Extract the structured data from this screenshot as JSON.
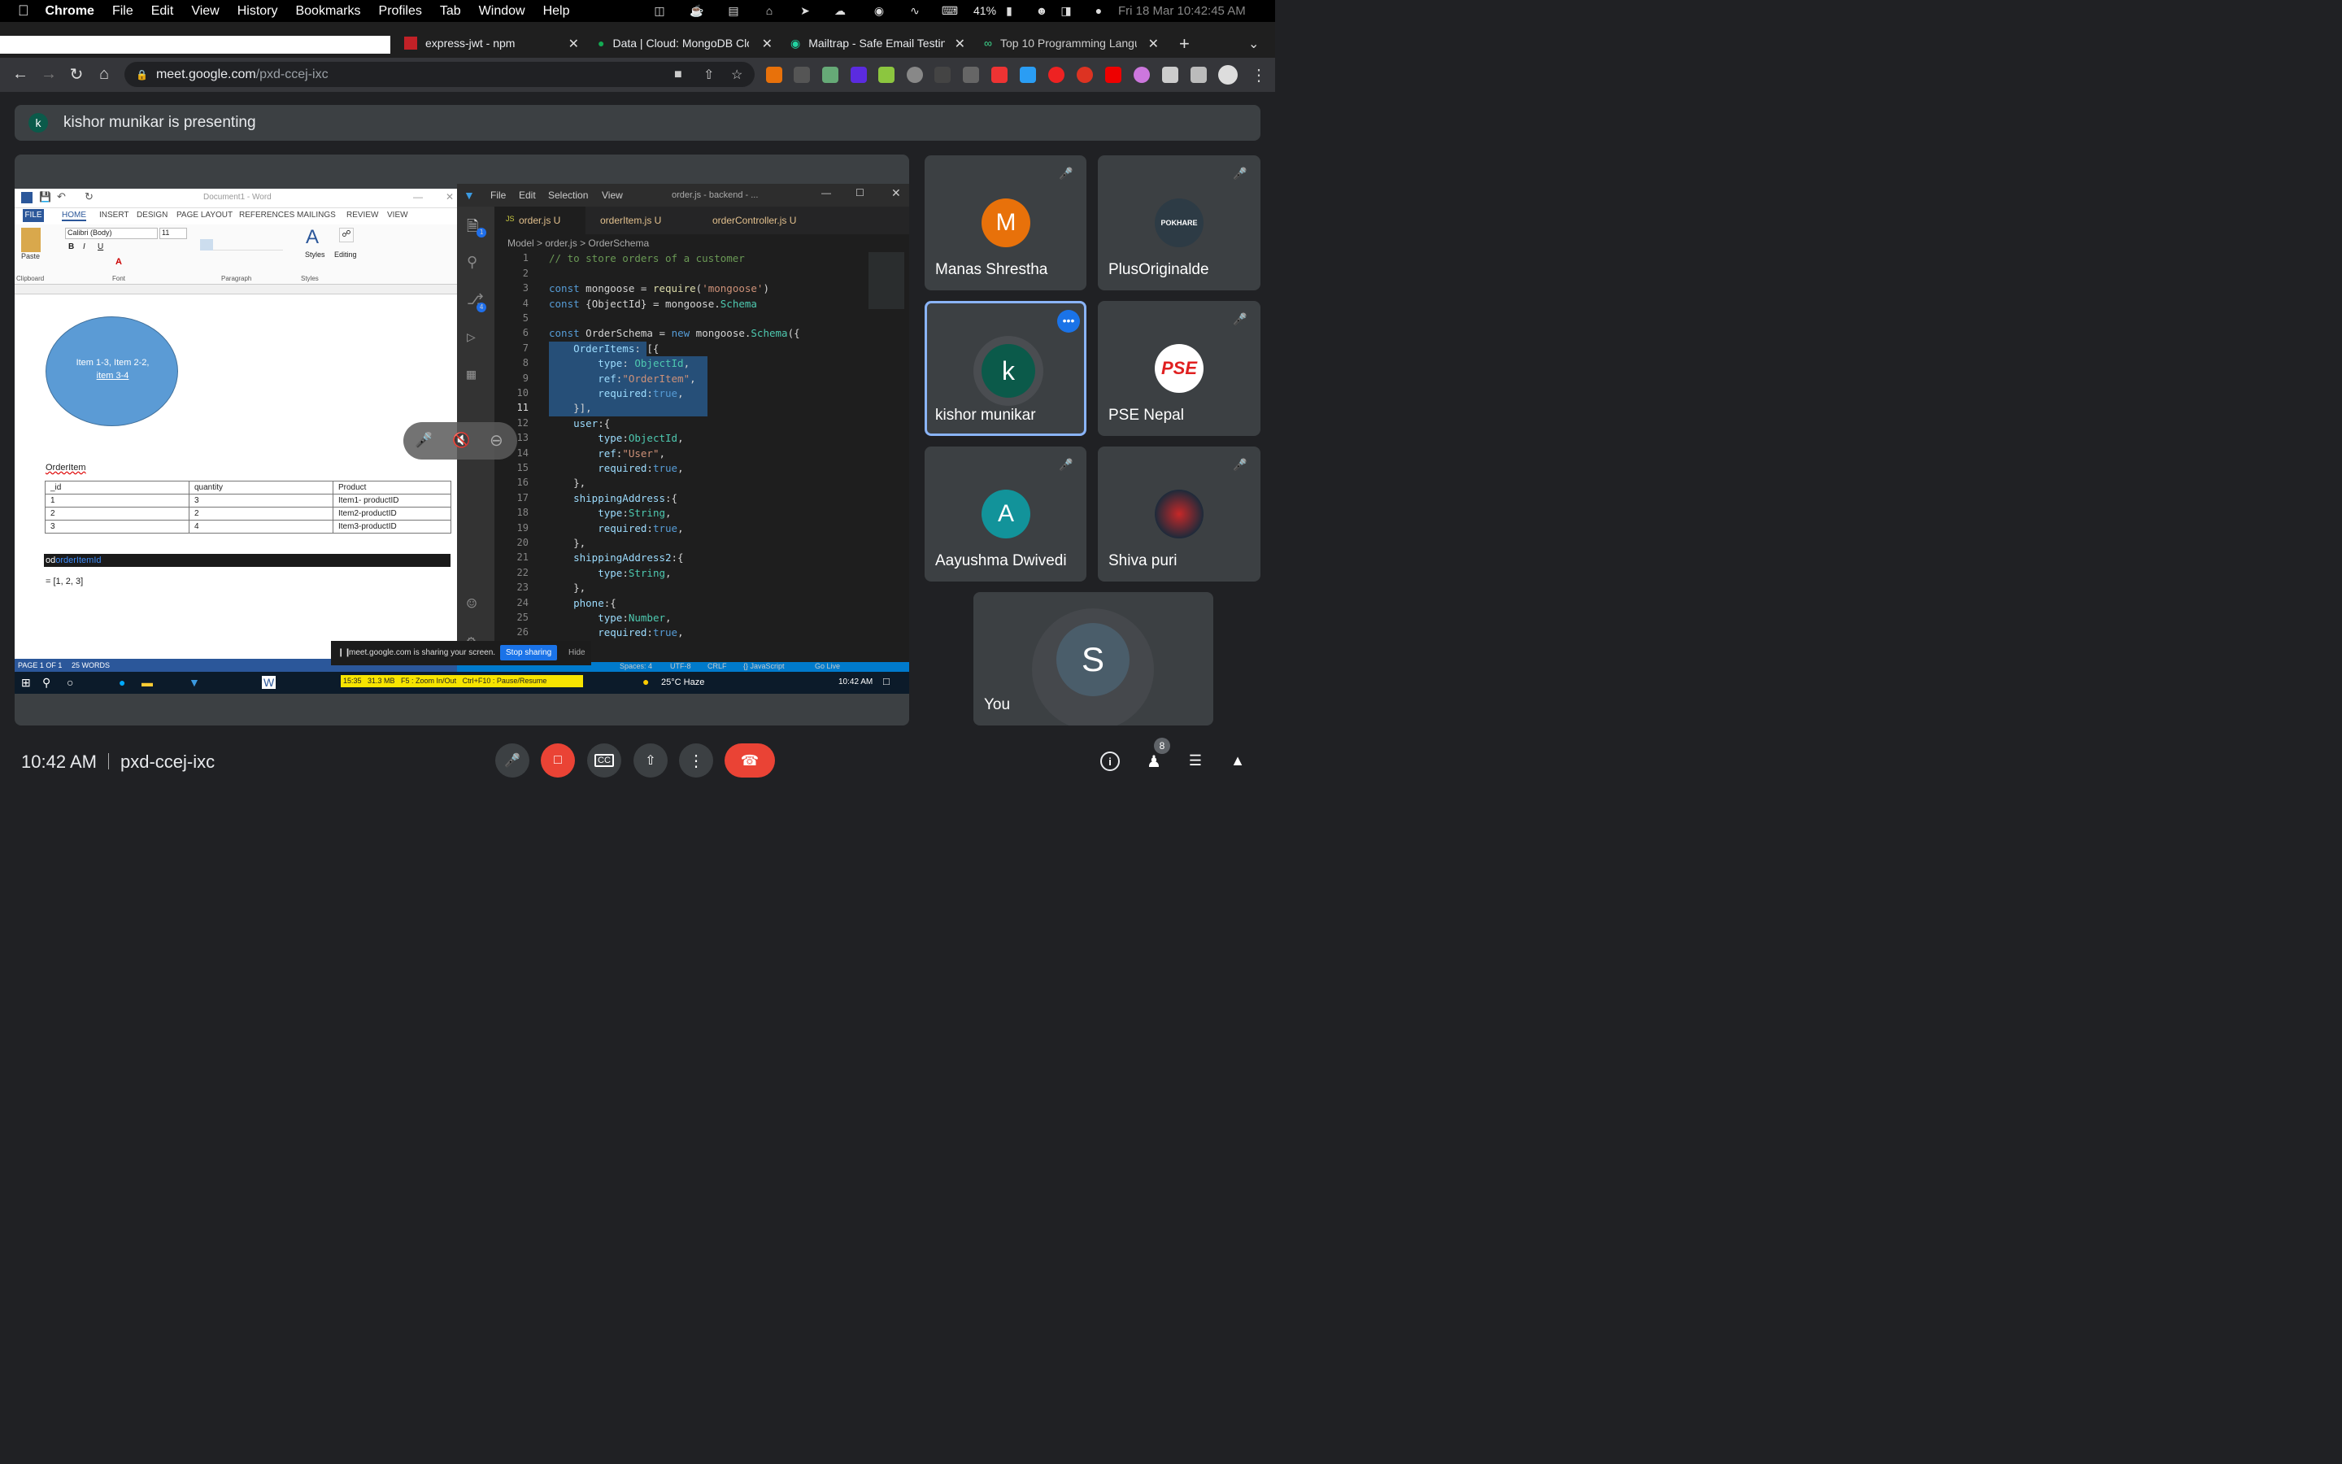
{
  "menubar": {
    "app": "Chrome",
    "items": [
      "File",
      "Edit",
      "View",
      "History",
      "Bookmarks",
      "Profiles",
      "Tab",
      "Window",
      "Help"
    ],
    "battery": "41%",
    "datetime": "Fri 18 Mar  10:42:45 AM"
  },
  "tabs": [
    {
      "label": "express-jwt - npm"
    },
    {
      "label": "Data | Cloud: MongoDB Clo"
    },
    {
      "label": "Mailtrap - Safe Email Testin"
    },
    {
      "label": "Top 10 Programming Langu"
    }
  ],
  "address": {
    "host": "meet.google.com",
    "path": "/pxd-ccej-ixc"
  },
  "meet": {
    "presenter_initial": "k",
    "presenting_text": "kishor munikar is presenting",
    "meeting_time": "10:42 AM",
    "meeting_code": "pxd-ccej-ixc",
    "people_count": "8",
    "participants": [
      {
        "name": "Manas Shrestha",
        "initial": "M",
        "color": "#e8710a"
      },
      {
        "name": "PlusOriginalde",
        "avatar_text": "POKHARE"
      },
      {
        "name": "kishor munikar",
        "initial": "k",
        "color": "#0b5a4a"
      },
      {
        "name": "PSE Nepal",
        "avatar_text": "PSE"
      },
      {
        "name": "Aayushma Dwivedi",
        "initial": "A",
        "color": "#12939a"
      },
      {
        "name": "Shiva puri"
      },
      {
        "name": "You",
        "initial": "S",
        "color": "#4a5d6a"
      }
    ],
    "share_banner": {
      "text": "meet.google.com is sharing your screen.",
      "stop": "Stop sharing",
      "hide": "Hide"
    }
  },
  "word": {
    "title": "Document1 - Word",
    "ribbon_tabs": [
      "FILE",
      "HOME",
      "INSERT",
      "DESIGN",
      "PAGE LAYOUT",
      "REFERENCES",
      "MAILINGS",
      "REVIEW",
      "VIEW"
    ],
    "font_name": "Calibri (Body)",
    "font_size": "11",
    "groups": [
      "Clipboard",
      "Font",
      "Paragraph",
      "Styles"
    ],
    "paste": "Paste",
    "styles": "Styles",
    "editing": "Editing",
    "ellipse_line1": "Item 1-3, Item 2-2,",
    "ellipse_line2": "item 3-4",
    "section_label": "OrderItem",
    "table_headers": [
      "_id",
      "quantity",
      "Product"
    ],
    "table_rows": [
      [
        "1",
        "3",
        "Item1- productID"
      ],
      [
        "2",
        "2",
        "Item2-productID"
      ],
      [
        "3",
        "4",
        "Item3-productID"
      ]
    ],
    "code_bar_prefix": "od",
    "code_bar_text": "orderItemId",
    "array_line": "= [1, 2, 3]",
    "status_page": "PAGE 1 OF 1",
    "status_words": "25 WORDS"
  },
  "vscode": {
    "menus": [
      "File",
      "Edit",
      "Selection",
      "View"
    ],
    "title": "order.js - backend - ...",
    "tabs": [
      "order.js  U",
      "orderItem.js  U",
      "orderController.js  U"
    ],
    "breadcrumb": [
      "Model",
      "order.js",
      "OrderSchema"
    ],
    "status": [
      "Spaces: 4",
      "UTF-8",
      "CRLF",
      "{} JavaScript",
      "Go Live"
    ],
    "badges": [
      "1",
      "4"
    ]
  },
  "taskbar": {
    "recorder": "15:35   31.3 MB   F5 : Zoom In/Out   Ctrl+F10 : Pause/Resume",
    "weather": "25°C  Haze",
    "time": "10:42 AM"
  }
}
